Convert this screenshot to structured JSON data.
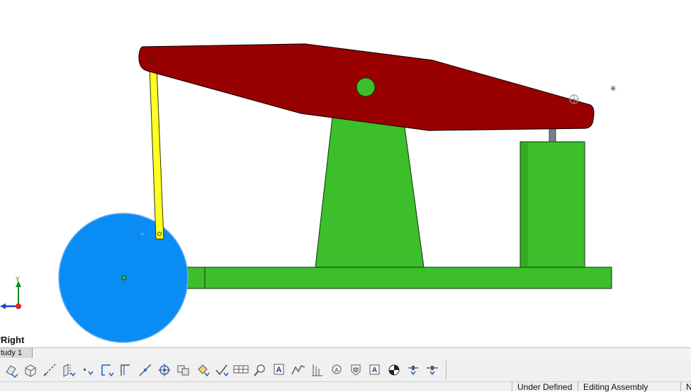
{
  "viewport": {
    "view_name": "*Right",
    "colors": {
      "beam": "#990000",
      "green_parts": "#3cbf2a",
      "flywheel": "#0a8cf5",
      "rod": "#ffff22",
      "rod_cylinder": "#7a7f8a",
      "background": "#ffffff"
    },
    "triad_axes": [
      "Y",
      "Z"
    ]
  },
  "study_tabs": [
    {
      "label": "tudy 1",
      "active": true
    }
  ],
  "toolbar": {
    "buttons": [
      {
        "name": "mate-icon"
      },
      {
        "name": "linear-pattern-icon"
      },
      {
        "name": "smart-dimension-icon"
      },
      {
        "name": "reference-geometry-icon"
      },
      {
        "name": "point-icon"
      },
      {
        "name": "sketch-icon"
      },
      {
        "name": "line-icon"
      },
      {
        "name": "construction-line-icon"
      },
      {
        "name": "center-of-mass-icon"
      },
      {
        "name": "insert-component-icon"
      },
      {
        "name": "paint-bucket-icon"
      },
      {
        "name": "check-icon"
      },
      {
        "name": "bill-of-materials-icon"
      },
      {
        "name": "zoom-icon"
      },
      {
        "name": "note-icon"
      },
      {
        "name": "surface-finish-icon"
      },
      {
        "name": "datum-feature-icon"
      },
      {
        "name": "geometric-tolerance-icon"
      },
      {
        "name": "shaded-icon"
      },
      {
        "name": "datum-target-icon"
      },
      {
        "name": "appearance-icon"
      },
      {
        "name": "center-mark-icon"
      },
      {
        "name": "centerline-icon"
      }
    ]
  },
  "status_bar": {
    "left_text": "Under Defined",
    "right_text": "Editing Assembly",
    "last_text": "N"
  }
}
